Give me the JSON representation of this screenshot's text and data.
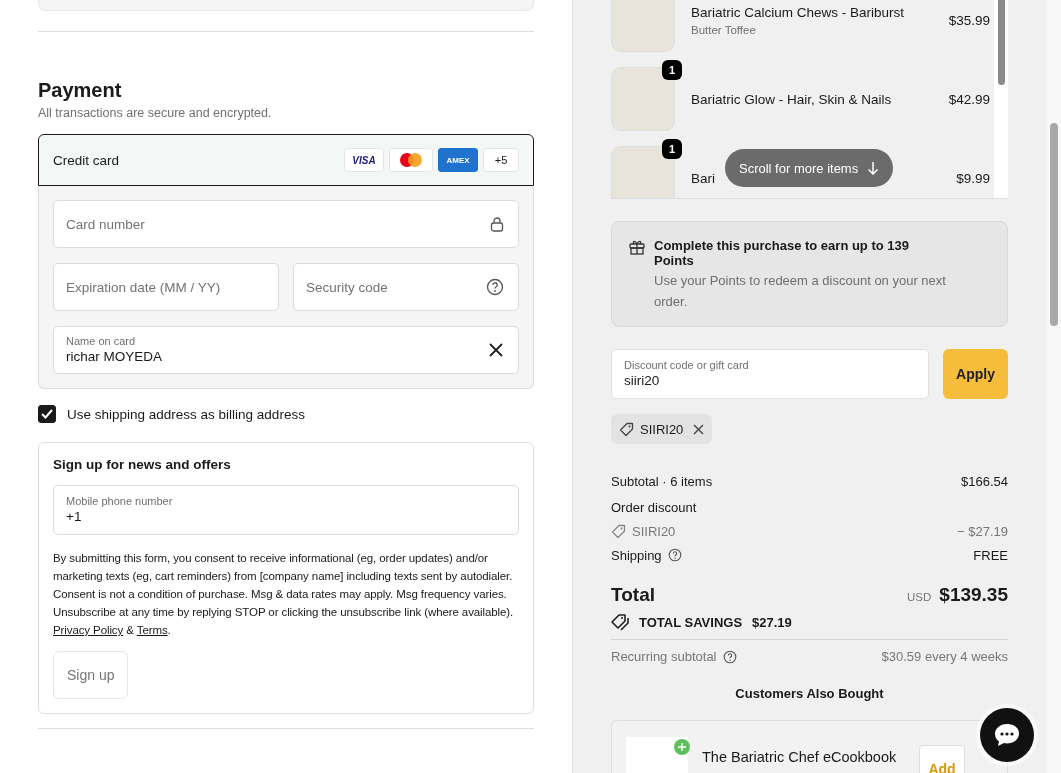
{
  "payment": {
    "title": "Payment",
    "subtitle": "All transactions are secure and encrypted.",
    "method": {
      "label": "Credit card",
      "selected": true,
      "brands": [
        {
          "kind": "visa",
          "label": "VISA"
        },
        {
          "kind": "mastercard"
        },
        {
          "kind": "amex",
          "label": "AMEX"
        }
      ],
      "more": "+5"
    },
    "fields": [
      {
        "kind": "card",
        "placeholder": "Card number"
      },
      {
        "kind": "expiry",
        "placeholder": "Expiration date (MM / YY)"
      },
      {
        "kind": "cvc",
        "placeholder": "Security code"
      },
      {
        "kind": "name",
        "label": "Name on card",
        "value": "richar MOYEDA"
      }
    ],
    "billing_same": {
      "label": "Use shipping address as billing address",
      "checked": true
    }
  },
  "signup": {
    "title": "Sign up for news and offers",
    "phone": {
      "label": "Mobile phone number",
      "value": "+1"
    },
    "consent": "By submitting this form, you consent to receive informational (eg, order updates) and/or marketing texts (eg, cart reminders) from [company name] including texts sent by autodialer. Consent is not a condition of purchase. Msg & data rates may apply. Msg frequency varies. Unsubscribe at any time by replying STOP or clicking the unsubscribe link (where available).",
    "links": [
      "Privacy Policy",
      "Terms"
    ],
    "joiner": "&",
    "end": ".",
    "button": "Sign up"
  },
  "cart": {
    "items": [
      {
        "name": "Bariatric Calcium Chews - Bariburst",
        "variant": "Butter Toffee",
        "price": "$35.99"
      },
      {
        "name": "Bariatric Glow - Hair, Skin & Nails",
        "price": "$42.99",
        "quantity": "1"
      },
      {
        "name": "Bari",
        "price": "$9.99",
        "quantity": "1"
      }
    ],
    "scroll_hint": "Scroll for more items"
  },
  "points": {
    "title": "Complete this purchase to earn up to 139 Points",
    "text": "Use your Points to redeem a discount on your next order."
  },
  "discount": {
    "label": "Discount code or gift card",
    "value": "siiri20",
    "button": "Apply",
    "applied": [
      "SIIRI20"
    ]
  },
  "summary": [
    {
      "kind": "line",
      "label": "Subtotal · 6 items",
      "value": "$166.54"
    },
    {
      "kind": "heading",
      "label": "Order discount"
    },
    {
      "kind": "code",
      "label": "SIIRI20",
      "value": "− $27.19"
    },
    {
      "kind": "help",
      "label": "Shipping",
      "value": "FREE"
    }
  ],
  "total": {
    "label": "Total",
    "currency": "USD",
    "value": "$139.35",
    "savings_label": "TOTAL SAVINGS",
    "savings": "$27.19"
  },
  "recurring": {
    "label": "Recurring subtotal",
    "value": "$30.59 every 4 weeks"
  },
  "upsell": {
    "title": "Customers Also Bought",
    "items": [
      {
        "name": "The Bariatric Chef eCookbook",
        "button": "Add"
      }
    ]
  }
}
